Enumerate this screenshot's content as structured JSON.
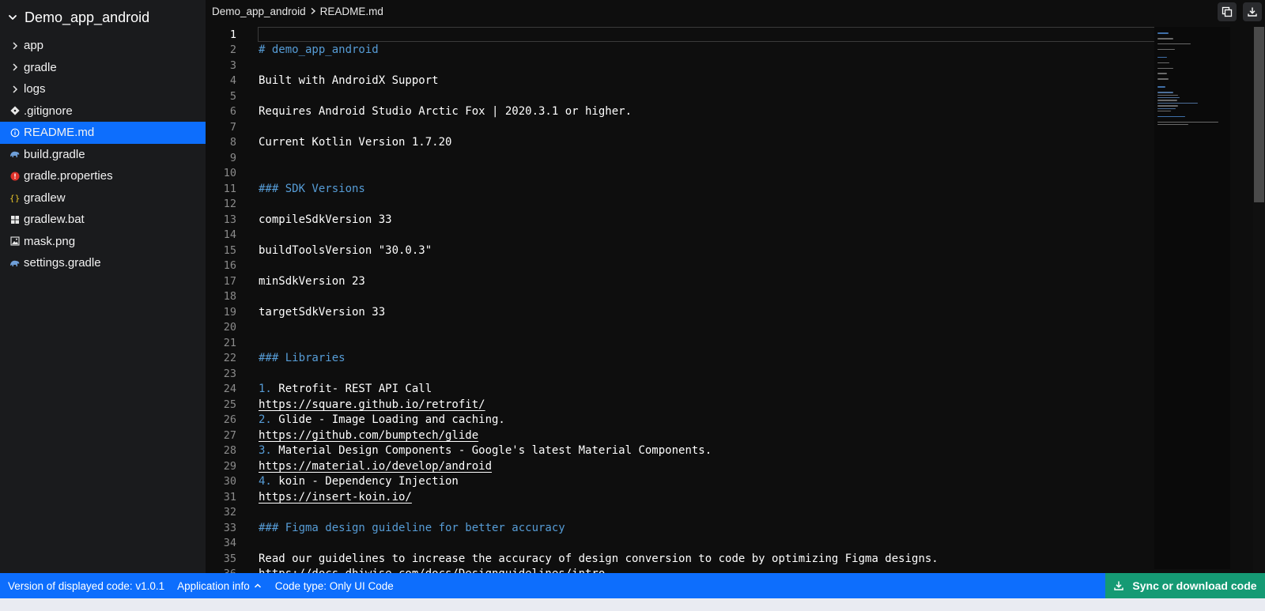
{
  "sidebar": {
    "project_name": "Demo_app_android",
    "items": [
      {
        "label": "app",
        "icon": "chevron-right-icon"
      },
      {
        "label": "gradle",
        "icon": "chevron-right-icon"
      },
      {
        "label": "logs",
        "icon": "chevron-right-icon"
      },
      {
        "label": ".gitignore",
        "icon": "git-icon"
      },
      {
        "label": "README.md",
        "icon": "info-icon",
        "active": true
      },
      {
        "label": "build.gradle",
        "icon": "gradle-elephant-icon"
      },
      {
        "label": "gradle.properties",
        "icon": "properties-icon"
      },
      {
        "label": "gradlew",
        "icon": "braces-icon"
      },
      {
        "label": "gradlew.bat",
        "icon": "windows-icon"
      },
      {
        "label": "mask.png",
        "icon": "image-icon"
      },
      {
        "label": "settings.gradle",
        "icon": "gradle-elephant-icon"
      }
    ]
  },
  "breadcrumb": {
    "project": "Demo_app_android",
    "file": "README.md"
  },
  "toolbar": {
    "copy_icon": "copy-icon",
    "download_icon": "download-icon"
  },
  "editor": {
    "current_line": 1,
    "lines": [
      "",
      "# demo_app_android",
      "",
      "Built with AndroidX Support",
      "",
      "Requires Android Studio Arctic Fox | 2020.3.1 or higher.",
      "",
      "Current Kotlin Version 1.7.20",
      "",
      "",
      "### SDK Versions",
      "",
      "compileSdkVersion 33",
      "",
      "buildToolsVersion \"30.0.3\"",
      "",
      "minSdkVersion 23",
      "",
      "targetSdkVersion 33",
      "",
      "",
      "### Libraries",
      "",
      "1. Retrofit- REST API Call",
      "https://square.github.io/retrofit/",
      "2. Glide - Image Loading and caching.",
      "https://github.com/bumptech/glide",
      "3. Material Design Components - Google's latest Material Components.",
      "https://material.io/develop/android",
      "4. koin - Dependency Injection",
      "https://insert-koin.io/",
      "",
      "### Figma design guideline for better accuracy",
      "",
      "Read our guidelines to increase the accuracy of design conversion to code by optimizing Figma designs.",
      "https://docs.dhiwise.com/docs/Designguidelines/intro"
    ]
  },
  "statusbar": {
    "version": "Version of displayed code: v1.0.1",
    "app_info": "Application info",
    "code_type": "Code type: Only UI Code",
    "sync_label": "Sync or download code"
  },
  "colors": {
    "accent": "#0d6efd",
    "sync_button": "#159a74",
    "heading": "#569cd6",
    "editor_bg": "#0e0e0e",
    "sidebar_bg": "#1a1b1d"
  }
}
